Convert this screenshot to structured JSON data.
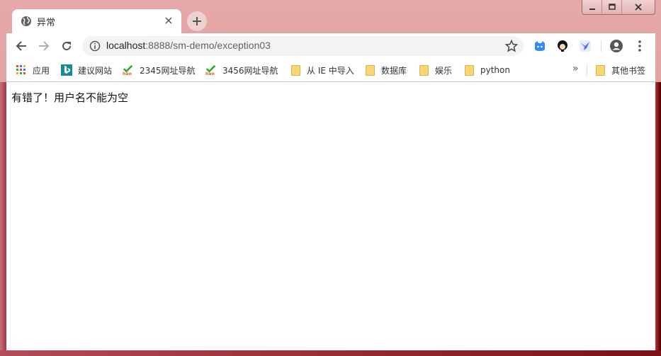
{
  "window": {
    "controls": [
      "minimize-icon",
      "maximize-icon",
      "close-icon"
    ]
  },
  "tab": {
    "title": "异常",
    "favicon": "globe-icon"
  },
  "toolbar": {
    "url_host": "localhost",
    "url_rest": ":8888/sm-demo/exception03",
    "extensions": [
      "bot-icon",
      "avatar-ext-icon",
      "bird-icon"
    ],
    "profile": "account-icon",
    "menu": "more-vert-icon"
  },
  "bookmarks": {
    "items": [
      {
        "label": "应用",
        "icon": "apps-grid-icon"
      },
      {
        "label": "建议网站",
        "icon": "bing-icon"
      },
      {
        "label": "2345网址导航",
        "icon": "hao-icon"
      },
      {
        "label": "3456网址导航",
        "icon": "hao-icon"
      },
      {
        "label": "从 IE 中导入",
        "icon": "folder-icon"
      },
      {
        "label": "数据库",
        "icon": "folder-icon"
      },
      {
        "label": "娱乐",
        "icon": "folder-icon"
      },
      {
        "label": "python",
        "icon": "folder-icon"
      }
    ],
    "overflow": "»",
    "other_label": "其他书签"
  },
  "page": {
    "message": "有错了！用户名不能为空"
  }
}
